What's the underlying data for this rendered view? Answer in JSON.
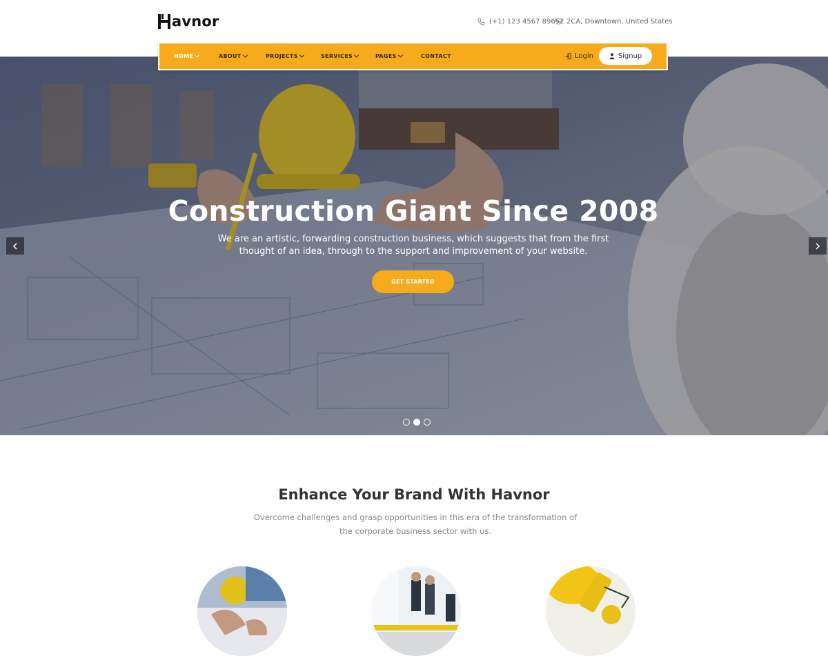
{
  "brand": {
    "name": "avnor"
  },
  "contact": {
    "phone": "(+1) 123 4567 89652",
    "address": "2CA, Downtown, United States"
  },
  "nav": {
    "items": [
      {
        "label": "HOME",
        "dropdown": true
      },
      {
        "label": "ABOUT",
        "dropdown": true
      },
      {
        "label": "PROJECTS",
        "dropdown": true
      },
      {
        "label": "SERVICES",
        "dropdown": true
      },
      {
        "label": "PAGES",
        "dropdown": true
      },
      {
        "label": "CONTACT",
        "dropdown": false
      }
    ],
    "login": "Login",
    "signup": "Signup"
  },
  "hero": {
    "title": "Construction Giant Since 2008",
    "subtitle": "We are an artistic, forwarding construction business, which suggests that from the first thought of an idea, through to the support and improvement of your website.",
    "cta": "GET STARTED",
    "slides": 3,
    "active_slide": 2
  },
  "intro": {
    "title": "Enhance Your Brand With Havnor",
    "subtitle": "Overcome challenges and grasp opportunities in this era of the transformation of the corporate business sector with us."
  },
  "colors": {
    "accent": "#f6ab1c",
    "text_dark": "#333333",
    "text_muted": "#888888"
  }
}
